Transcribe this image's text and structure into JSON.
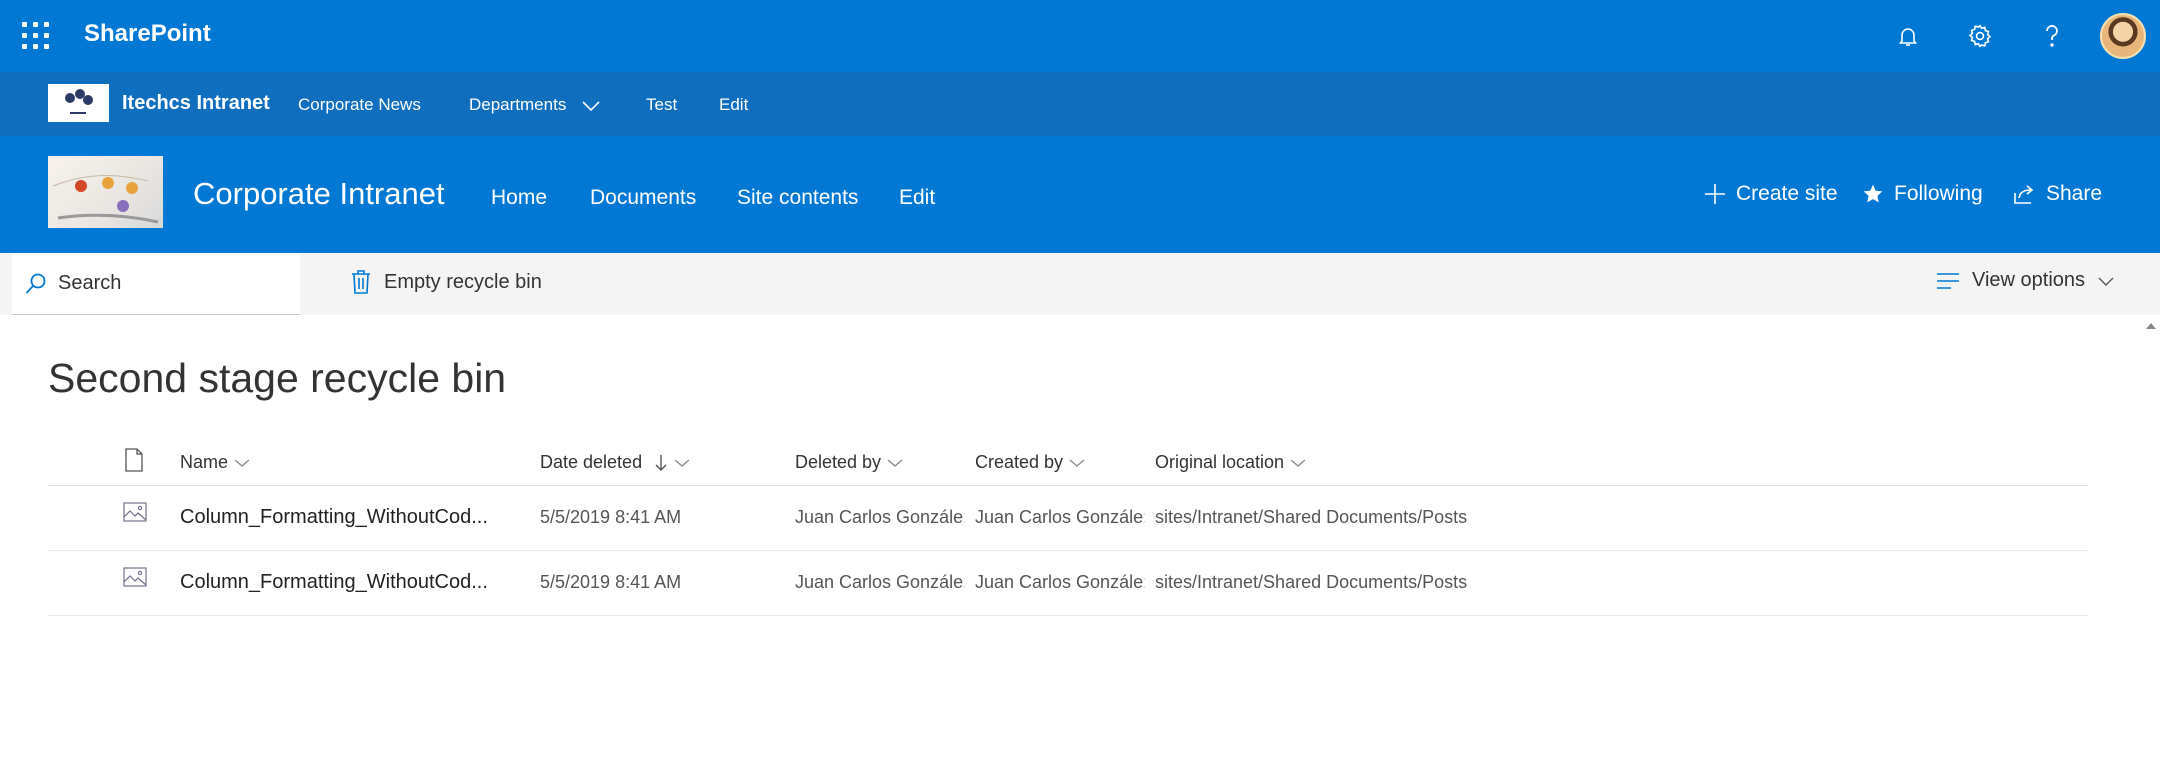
{
  "suite": {
    "brand": "SharePoint",
    "icons": [
      "waffle-icon",
      "bell-icon",
      "gear-icon",
      "help-icon"
    ]
  },
  "hub": {
    "title": "Itechcs Intranet",
    "links": [
      "Corporate News",
      "Departments",
      "Test",
      "Edit"
    ]
  },
  "site": {
    "title": "Corporate Intranet",
    "nav": [
      "Home",
      "Documents",
      "Site contents",
      "Edit"
    ],
    "actions": {
      "create": "Create site",
      "following": "Following",
      "share": "Share"
    }
  },
  "commandbar": {
    "search": "Search",
    "empty": "Empty recycle bin",
    "view": "View options"
  },
  "page": {
    "title": "Second stage recycle bin"
  },
  "columns": {
    "name": "Name",
    "date": "Date deleted",
    "deleted_by": "Deleted by",
    "created_by": "Created by",
    "location": "Original location"
  },
  "rows": [
    {
      "name": "Column_Formatting_WithoutCod...",
      "date": "5/5/2019 8:41 AM",
      "deleted_by": "Juan Carlos Gonzále;",
      "created_by": "Juan Carlos Gonzále;",
      "location": "sites/Intranet/Shared Documents/Posts"
    },
    {
      "name": "Column_Formatting_WithoutCod...",
      "date": "5/5/2019 8:41 AM",
      "deleted_by": "Juan Carlos Gonzále;",
      "created_by": "Juan Carlos Gonzále;",
      "location": "sites/Intranet/Shared Documents/Posts"
    }
  ],
  "colors": {
    "suitebar": "#0078d4",
    "hubnav": "#106ebe",
    "accent": "#0078d4"
  }
}
